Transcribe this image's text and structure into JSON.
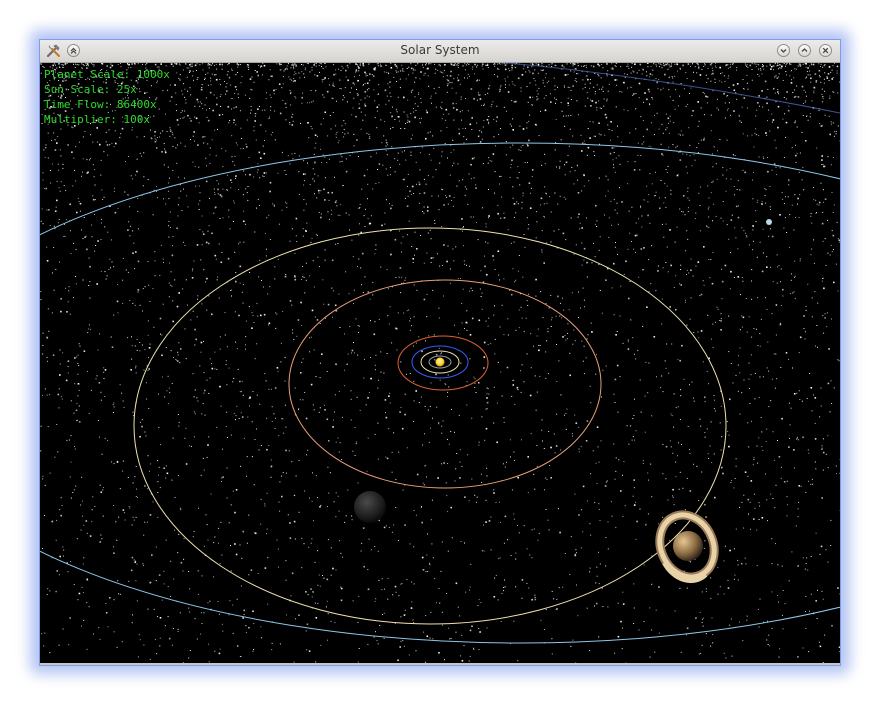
{
  "window": {
    "title": "Solar System",
    "app_icon": "wrench-hammer-icon",
    "left_buttons": [
      {
        "name": "menu-button",
        "icon": "chevron-up-double-icon"
      }
    ],
    "right_buttons": [
      {
        "name": "minimize-button",
        "icon": "chevron-down-icon"
      },
      {
        "name": "maximize-button",
        "icon": "chevron-up-icon"
      },
      {
        "name": "close-button",
        "icon": "close-icon"
      }
    ]
  },
  "hud": {
    "planet_scale": "Planet Scale: 1000x",
    "sun_scale": "Sun Scale: 25x",
    "time_flow": "Time Flow: 86400x",
    "multiplier": "Multiplier: 100x"
  },
  "colors": {
    "hud_text": "#2fd82f",
    "background": "#000000",
    "sun": "#ffd23a",
    "orbit_mercury": "#9a9a9a",
    "orbit_venus": "#e8e0b8",
    "orbit_earth": "#3a5cff",
    "orbit_mars": "#e0603a",
    "orbit_jupiter": "#e8a078",
    "orbit_saturn": "#f0e2b0",
    "orbit_uranus": "#8ec8e8",
    "orbit_neptune": "#4a6ab8",
    "window_glow": "#aabdf3"
  }
}
